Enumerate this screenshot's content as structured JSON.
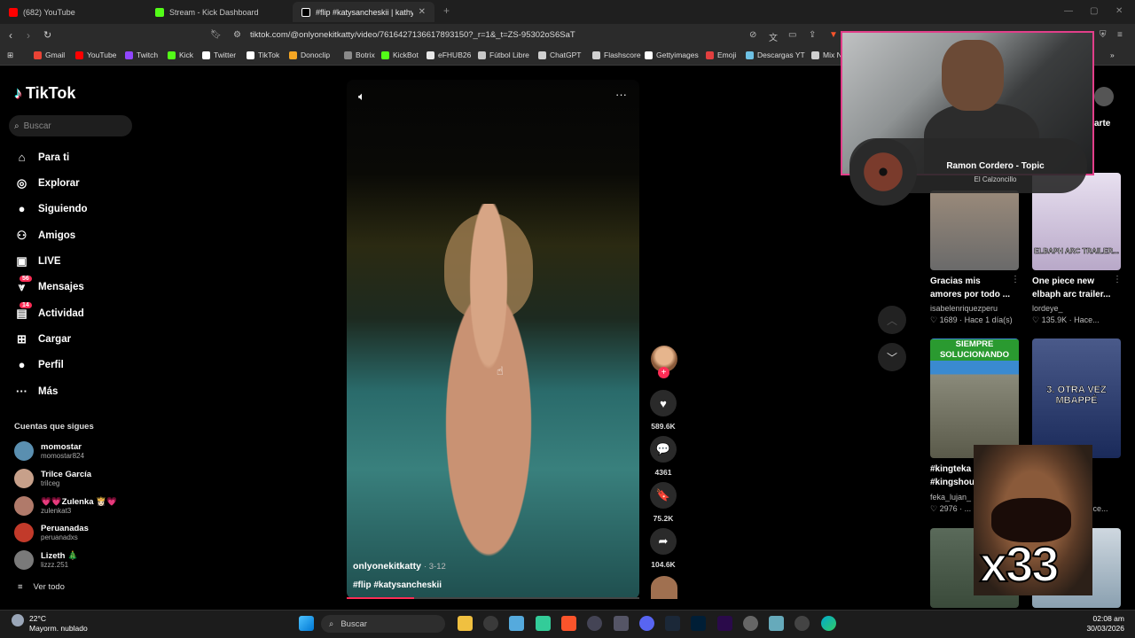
{
  "browser": {
    "tabs": [
      {
        "title": "(682) YouTube",
        "color": "#ff0000"
      },
      {
        "title": "Stream - Kick Dashboard",
        "color": "#53fc18"
      },
      {
        "title": "#flip #katysancheskii | kathy san",
        "color": "#ffffff"
      }
    ],
    "url": "tiktok.com/@onlyonekitkatty/video/7616427136617893150?_r=1&_t=ZS-95302oS6SaT",
    "bookmarks": [
      {
        "label": "Gmail",
        "color": "#ea4335"
      },
      {
        "label": "YouTube",
        "color": "#ff0000"
      },
      {
        "label": "Twitch",
        "color": "#9146ff"
      },
      {
        "label": "Kick",
        "color": "#53fc18"
      },
      {
        "label": "Twitter",
        "color": "#ffffff"
      },
      {
        "label": "TikTok",
        "color": "#ffffff"
      },
      {
        "label": "Donoclip",
        "color": "#f5a623"
      },
      {
        "label": "Botrix",
        "color": "#8a8a8a"
      },
      {
        "label": "KickBot",
        "color": "#53fc18"
      },
      {
        "label": "eFHUB26",
        "color": "#e8e8e8"
      },
      {
        "label": "Fútbol Libre",
        "color": "#c8c8c8"
      },
      {
        "label": "ChatGPT",
        "color": "#cfcfcf"
      },
      {
        "label": "Flashscore",
        "color": "#d0d0d0"
      },
      {
        "label": "Gettyimages",
        "color": "#ffffff"
      },
      {
        "label": "Emoji",
        "color": "#e23f3f"
      },
      {
        "label": "Descargas YT",
        "color": "#6ec1e4"
      },
      {
        "label": "Mix N",
        "color": "#cfcfcf"
      }
    ]
  },
  "tiktok": {
    "logo": "TikTok",
    "search_placeholder": "Buscar",
    "nav": [
      {
        "label": "Para ti",
        "icon": "home-icon",
        "glyph": "⌂"
      },
      {
        "label": "Explorar",
        "icon": "compass-icon",
        "glyph": "◎"
      },
      {
        "label": "Siguiendo",
        "icon": "following-avatar-icon",
        "glyph": "●"
      },
      {
        "label": "Amigos",
        "icon": "friends-icon",
        "glyph": "⚇"
      },
      {
        "label": "LIVE",
        "icon": "live-icon",
        "glyph": "▣"
      },
      {
        "label": "Mensajes",
        "icon": "messages-icon",
        "glyph": "⩔",
        "badge": "56"
      },
      {
        "label": "Actividad",
        "icon": "activity-icon",
        "glyph": "▤",
        "badge": "14"
      },
      {
        "label": "Cargar",
        "icon": "upload-icon",
        "glyph": "⊞"
      },
      {
        "label": "Perfil",
        "icon": "profile-avatar-icon",
        "glyph": "●"
      },
      {
        "label": "Más",
        "icon": "more-icon",
        "glyph": "···"
      }
    ],
    "following_title": "Cuentas que sigues",
    "following": [
      {
        "name": "momostar",
        "handle": "momostar824",
        "color": "#5a8fb0"
      },
      {
        "name": "Trilce García",
        "handle": "trilceg",
        "color": "#c7a08a"
      },
      {
        "name": "💗💗Zulenka 👸🏻💗",
        "handle": "zulenkat3",
        "color": "#b07a6a"
      },
      {
        "name": "Peruanadas",
        "handle": "peruanadxs",
        "color": "#c23a2a"
      },
      {
        "name": "Lizeth 🎄",
        "handle": "lizzz.251",
        "color": "#7a7a7a"
      }
    ],
    "see_all": "Ver todo",
    "video": {
      "author": "onlyonekitkatty",
      "date": "· 3-12",
      "tags": "#flip #katysancheskii",
      "progress": 0.23
    },
    "actions": [
      {
        "icon": "heart-icon",
        "glyph": "♥",
        "count": "589.6K"
      },
      {
        "icon": "comment-icon",
        "glyph": "💬",
        "count": "4361"
      },
      {
        "icon": "bookmark-icon",
        "glyph": "🔖",
        "count": "75.2K"
      },
      {
        "icon": "share-icon",
        "glyph": "➦",
        "count": "104.6K"
      }
    ],
    "right_cards": [
      {
        "title1": "Gracias mis",
        "title2": "amores por todo ...",
        "author": "isabelenriquezperu",
        "stats": "♡ 1689 · Hace 1 día(s)"
      },
      {
        "title1": "One piece new",
        "title2": "elbaph arc trailer...",
        "author": "lordeye_",
        "stats": "♡ 135.9K · Hace..."
      },
      {
        "title1": "#kingteka",
        "title2": "#kingshou",
        "author": "feka_lujan_",
        "stats": "♡ 2976 · ..."
      },
      {
        "title1": "",
        "title2": "",
        "author": "",
        "stats": "...ce..."
      }
    ],
    "thumb_texts": {
      "elbaph": "ELBAPH ARC TRAILER...",
      "siempre": "SIEMPRE SOLUCIONANDO",
      "otra_vez": "3. OTRA VEZ MBAPPÉ"
    },
    "right_header_partial": "arte"
  },
  "overlays": {
    "now_playing_title": "Ramon Cordero - Topic",
    "now_playing_sub": "El Calzoncillo",
    "meme_text": "x33"
  },
  "taskbar": {
    "weather_temp": "22°C",
    "weather_desc": "Mayorm. nublado",
    "search": "Buscar",
    "time": "02:08 am",
    "date": "30/03/2026"
  }
}
